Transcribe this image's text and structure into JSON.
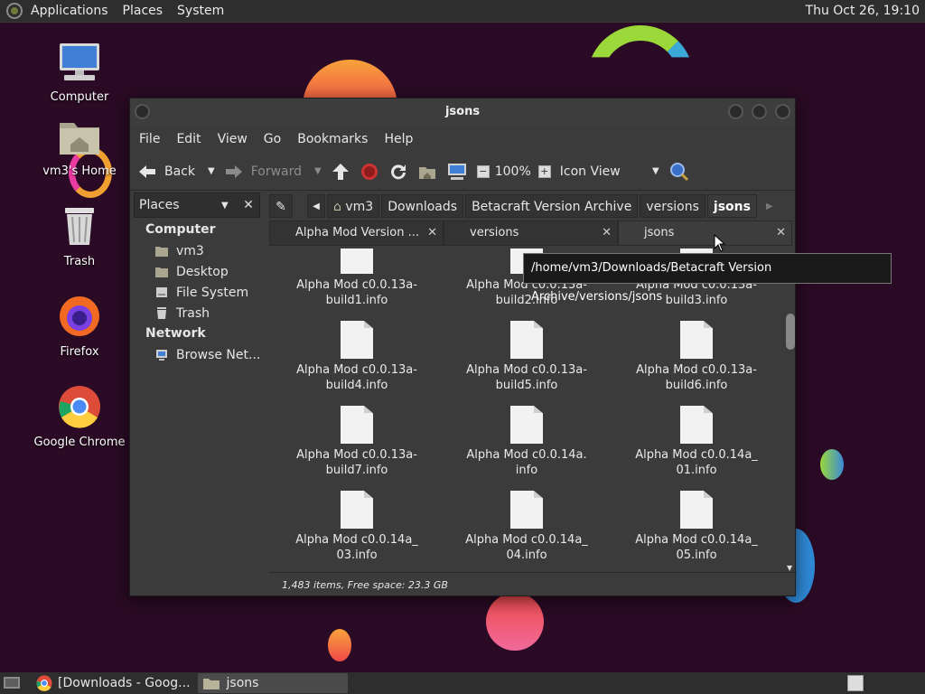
{
  "top_panel": {
    "menus": [
      "Applications",
      "Places",
      "System"
    ],
    "clock": "Thu Oct 26, 19:10"
  },
  "desktop_icons": [
    {
      "label": "Computer"
    },
    {
      "label": "vm3's Home"
    },
    {
      "label": "Trash"
    },
    {
      "label": "Firefox"
    },
    {
      "label": "Google Chrome"
    }
  ],
  "window": {
    "title": "jsons",
    "menus": [
      "File",
      "Edit",
      "View",
      "Go",
      "Bookmarks",
      "Help"
    ],
    "toolbar": {
      "back": "Back",
      "forward": "Forward",
      "zoom": "100%",
      "view_mode": "Icon View"
    },
    "sidebar": {
      "selector": "Places",
      "computer_heading": "Computer",
      "computer_items": [
        "vm3",
        "Desktop",
        "File System",
        "Trash"
      ],
      "network_heading": "Network",
      "network_items": [
        "Browse Net..."
      ]
    },
    "breadcrumbs": [
      "vm3",
      "Downloads",
      "Betacraft Version Archive",
      "versions",
      "jsons"
    ],
    "tabs": [
      {
        "label": "Alpha Mod Version ..."
      },
      {
        "label": "versions"
      },
      {
        "label": "jsons"
      }
    ],
    "files": [
      [
        "Alpha Mod c0.0.13a-",
        "build1.info"
      ],
      [
        "Alpha Mod c0.0.13a-",
        "build2.info"
      ],
      [
        "Alpha Mod c0.0.13a-",
        "build3.info"
      ],
      [
        "Alpha Mod c0.0.13a-",
        "build4.info"
      ],
      [
        "Alpha Mod c0.0.13a-",
        "build5.info"
      ],
      [
        "Alpha Mod c0.0.13a-",
        "build6.info"
      ],
      [
        "Alpha Mod c0.0.13a-",
        "build7.info"
      ],
      [
        "Alpha Mod c0.0.14a.",
        "info"
      ],
      [
        "Alpha Mod c0.0.14a_",
        "01.info"
      ],
      [
        "Alpha Mod c0.0.14a_",
        "03.info"
      ],
      [
        "Alpha Mod c0.0.14a_",
        "04.info"
      ],
      [
        "Alpha Mod c0.0.14a_",
        "05.info"
      ]
    ],
    "status": "1,483 items, Free space: 23.3 GB",
    "tooltip": "/home/vm3/Downloads/Betacraft Version Archive/versions/jsons"
  },
  "taskbar": [
    {
      "label": "[Downloads - Goog..."
    },
    {
      "label": "jsons"
    }
  ],
  "colors": {
    "desktop": "#2a0a24",
    "panel": "#2e2e2e",
    "window": "#3b3b3b"
  }
}
